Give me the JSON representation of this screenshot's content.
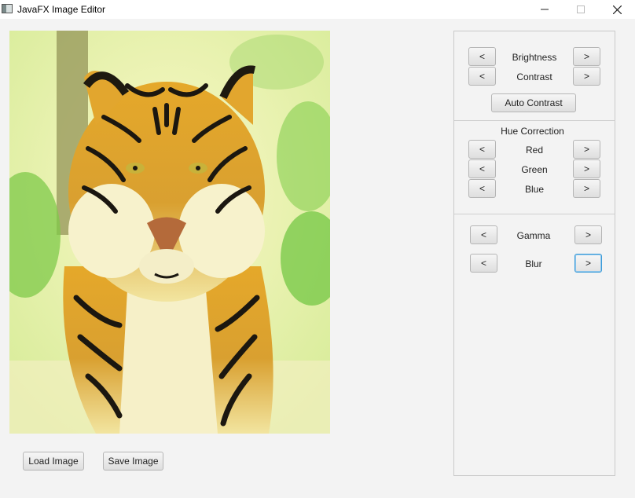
{
  "window": {
    "title": "JavaFX Image Editor",
    "minimize_glyph": "–",
    "maximize_glyph": "☐",
    "close_glyph": "✕"
  },
  "image": {
    "icon": "tiger-photo",
    "description_visible": false
  },
  "buttons": {
    "load_image": "Load Image",
    "save_image": "Save Image",
    "auto_contrast": "Auto Contrast",
    "decrease": "<",
    "increase": ">"
  },
  "adjustments": {
    "brightness": "Brightness",
    "contrast": "Contrast",
    "hue_correction": "Hue Correction",
    "red": "Red",
    "green": "Green",
    "blue": "Blue",
    "gamma": "Gamma",
    "blur": "Blur"
  },
  "colors": {
    "accent_focus": "#3a9bd8"
  }
}
